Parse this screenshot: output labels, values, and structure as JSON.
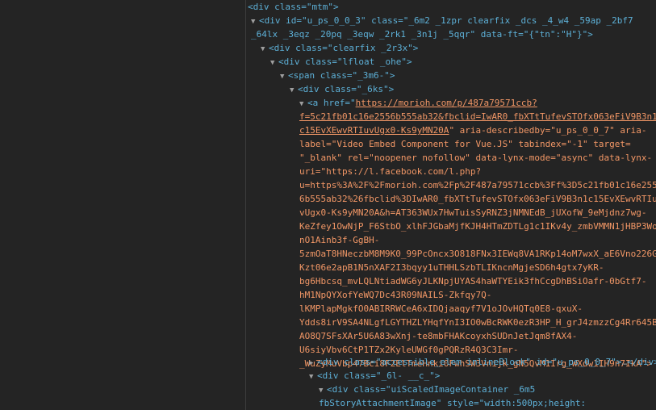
{
  "tree": {
    "line_mtm": "<div class=\"mtm\">",
    "line_ups_a": "<div id=\"u_ps_0_0_3\" class=\"_6m2 _1zpr clearfix _dcs _4_w4 _59ap _2bf7",
    "line_ups_b": "_64lx _3eqz _20pq _3eqw _2rk1 _3n1j _5qqr\" data-ft=\"{\"tn\":\"H\"}\">",
    "line_clearfix": "<div class=\"clearfix _2r3x\">",
    "line_lfloat": "<div class=\"lfloat _ohe\">",
    "line_span": "<span class=\"_3m6-\">",
    "line_6ks": "<div class=\"_6ks\">",
    "link": {
      "l1_pre": "<a href=\"",
      "l1_url": "https://morioh.com/p/487a79571ccb?",
      "l2_url": "f=5c21fb01c16e2556b555ab32&fbclid=IwAR0_fbXTtTufevSTOfx063eFiV9B3n1",
      "l3_url": "c15EvXEwvRTIuvUgx0-Ks9yMN20A",
      "l3_post": "\" aria-describedby=\"u_ps_0_0_7\" aria-",
      "l4": "label=\"Video Embed Component for Vue.JS\" tabindex=\"-1\" target=",
      "l5": "\"_blank\" rel=\"noopener nofollow\" data-lynx-mode=\"async\" data-lynx-",
      "l6": "uri=\"https://l.facebook.com/l.php?",
      "l7": "u=https%3A%2F%2Fmorioh.com%2Fp%2F487a79571ccb%3Ff%3D5c21fb01c16e255",
      "l8": "6b555ab32%26fbclid%3DIwAR0_fbXTtTufevSTOfx063eFiV9B3n1c15EvXEwvRTIu",
      "l9": "vUgx0-Ks9yMN20A&h=AT363WUx7HwTuisSyRNZ3jNMNEdB_jUXofW_9eMjdnz7wg-",
      "l10": "KeZfey1OwNjP_F6StbO_xlhFJGbaMjfKJH4HTmZDTLg1c1IKv4y_zmbVMMN1jHBP3Wo",
      "l11": "nO1Ainb3f-GgBH-",
      "l12": "5zmOaT8HNeczbM8M9K0_99PcOncx3O818FNx3IEWq8VA1RKp14oM7wxX_aE6Vno226G",
      "l13": "Kzt06e2apB1N5nXAF2I3bqyy1uTHHLSzbTLIKncnMgjeSD6h4gtx7yKR-",
      "l14": "bg6Hbcsq_mvLQLNtiadWG6yJLKNpjUYAS4haWTYEik3fhCcgDhBSiOafr-0bGtf7-",
      "l15": "hM1NpQYXofYeWQ7Dc43R09NAILS-Zkfqy7Q-",
      "l16": "lKMPlapMgkfO0ABIRRWCeA6xIDQjaaqyf7V1oJOvHQTq0E8-qxuX-",
      "l17": "Ydds8irV9SA4NLgfLGYTHZLYHqfYnI3IO0wBcRWK0ezR3HP_H_grJ4zmzzCg4Rr645B",
      "l18": "AO8Q7SFsXAr5U6A83wXnj-te8mbFHAKcoyxhSUDnJetJqm8fAX4-",
      "l19": "U6siyVbv6CtP1TZx2KyleUWGf0gPQRzR4Q3C3Imr-",
      "l20": "_WuZyMuVbp47Bci8F2ElTmeHnki0FwhSW3Vnijk_gN5QvM1Irg_WXdw1IH9n7IkA\">"
    },
    "line_access_pre": "<div class=\"accessible_elem inlineBlock\" id=\"u_ps_0_0_7\">",
    "line_access_ell": "…",
    "line_access_post": "</div>",
    "line_61": "<div class=\"_6l- __c_\">",
    "line_scaled_a": "<div class=\"uiScaledImageContainer _6m5",
    "line_scaled_b": "fbStoryAttachmentImage\" style=\"width:500px;height:"
  }
}
